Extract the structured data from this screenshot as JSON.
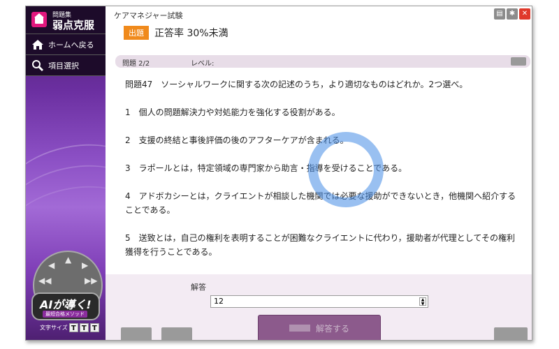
{
  "window": {
    "title": "ケアマネジャー試験"
  },
  "brand": {
    "sub": "問題集",
    "title": "弱点克服"
  },
  "sidebar": {
    "items": [
      {
        "label": "ホームへ戻る",
        "icon": "home-icon"
      },
      {
        "label": "項目選択",
        "icon": "search-icon"
      }
    ],
    "ai_badge": {
      "title": "AIが導く!",
      "subtitle": "最短合格メソッド"
    },
    "font_size": {
      "label": "文字サイズ",
      "buttons": [
        "T",
        "T",
        "T"
      ]
    }
  },
  "header": {
    "tag": "出題",
    "text": "正答率 30%未満"
  },
  "question_bar": {
    "number": "問題 2/2",
    "level_label": "レベル:"
  },
  "question": {
    "prompt": "問題47　ソーシャルワークに関する次の記述のうち，より適切なものはどれか。2つ選べ。",
    "options": [
      "1　個人の問題解決力や対処能力を強化する役割がある。",
      "2　支援の終結と事後評価の後のアフターケアが含まれる。",
      "3　ラポールとは，特定領域の専門家から助言・指導を受けることである。",
      "4　アドボカシーとは，クライエントが相談した機関では必要な援助ができないとき，他機関へ紹介することである。",
      "5　送致とは，自己の権利を表明することが困難なクライエントに代わり，援助者が代理としてその権利獲得を行うことである。"
    ]
  },
  "answer": {
    "label": "解答",
    "value": "12",
    "button_label": "解答する"
  },
  "colors": {
    "accent": "#f08a1c",
    "sidebar": "#6b2fa0",
    "close": "#e0392b"
  }
}
